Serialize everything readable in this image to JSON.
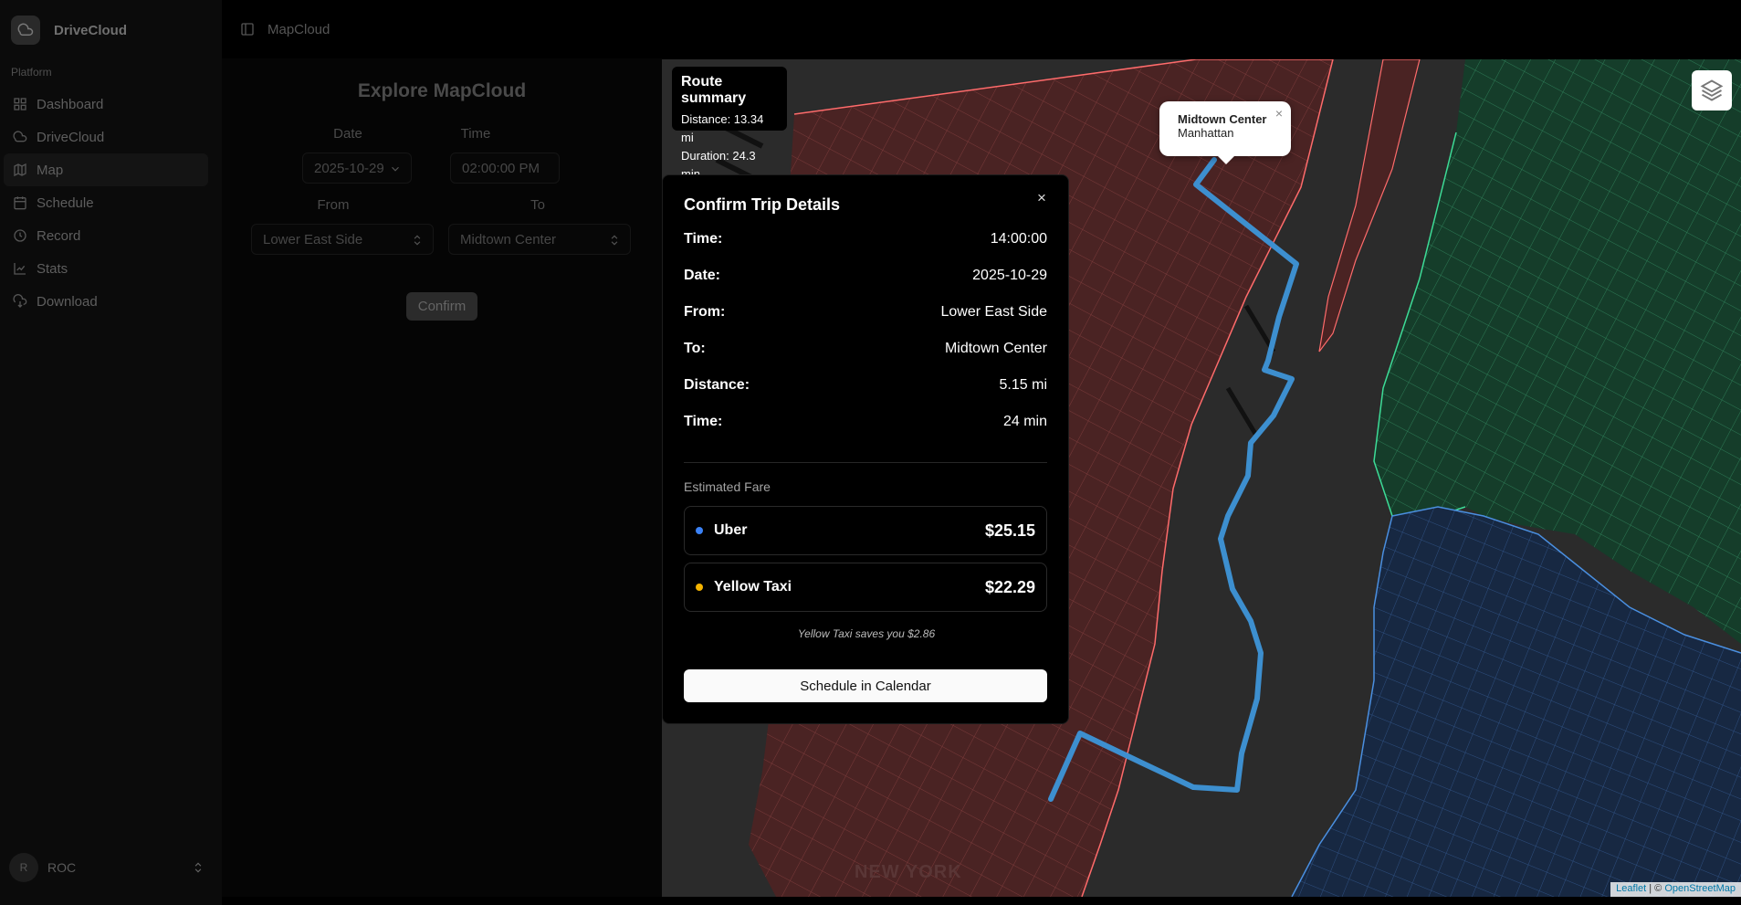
{
  "sidebar": {
    "brand": "DriveCloud",
    "group_label": "Platform",
    "items": [
      {
        "label": "Dashboard",
        "icon": "grid-icon"
      },
      {
        "label": "DriveCloud",
        "icon": "cloud-icon"
      },
      {
        "label": "Map",
        "icon": "map-icon",
        "active": true
      },
      {
        "label": "Schedule",
        "icon": "calendar-icon"
      },
      {
        "label": "Record",
        "icon": "record-icon"
      },
      {
        "label": "Stats",
        "icon": "chart-icon"
      },
      {
        "label": "Download",
        "icon": "download-icon"
      }
    ],
    "user": {
      "initial": "R",
      "name": "ROC"
    }
  },
  "topbar": {
    "title": "MapCloud"
  },
  "form": {
    "title": "Explore MapCloud",
    "date_label": "Date",
    "date_value": "2025-10-29",
    "time_label": "Time",
    "time_value": "02:00:00 PM",
    "from_label": "From",
    "from_value": "Lower East Side",
    "to_label": "To",
    "to_value": "Midtown Center",
    "confirm_label": "Confirm"
  },
  "map": {
    "route_summary": {
      "title": "Route summary",
      "distance": "Distance: 13.34 mi",
      "duration": "Duration: 24.3 min"
    },
    "popup": {
      "title": "Midtown Center",
      "subtitle": "Manhattan",
      "close": "×"
    },
    "label_new_york": "NEW YORK",
    "attribution": {
      "leaflet": "Leaflet",
      "separator": " | © ",
      "osm": "OpenStreetMap"
    },
    "colors": {
      "manhattan": "#4a2323",
      "manhattan_lines": "#ff6b6b",
      "queens": "#153d2a",
      "queens_lines": "#3ddc97",
      "brooklyn": "#172842",
      "brooklyn_lines": "#4a8fe0",
      "route": "#3d8fcf"
    }
  },
  "dialog": {
    "title": "Confirm Trip Details",
    "close": "×",
    "rows": [
      {
        "key": "Time:",
        "value": "14:00:00"
      },
      {
        "key": "Date:",
        "value": "2025-10-29"
      },
      {
        "key": "From:",
        "value": "Lower East Side"
      },
      {
        "key": "To:",
        "value": "Midtown Center"
      },
      {
        "key": "Distance:",
        "value": "5.15 mi"
      },
      {
        "key": "Time:",
        "value": "24 min"
      }
    ],
    "fare_label": "Estimated Fare",
    "fares": [
      {
        "name": "Uber",
        "price": "$25.15",
        "dot_color": "#3b82f6"
      },
      {
        "name": "Yellow Taxi",
        "price": "$22.29",
        "dot_color": "#f5b400"
      }
    ],
    "savings_note": "Yellow Taxi saves you $2.86",
    "schedule_button": "Schedule in Calendar"
  }
}
